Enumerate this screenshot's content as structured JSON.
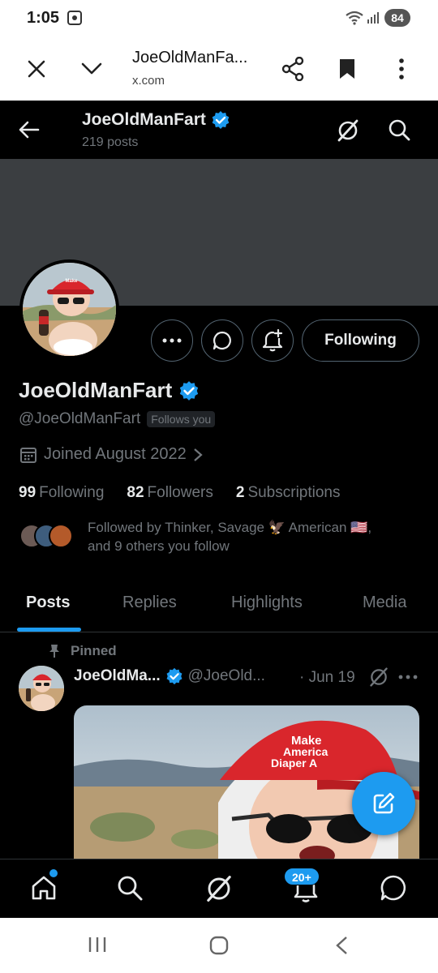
{
  "status_bar": {
    "time": "1:05",
    "battery": "84"
  },
  "browser": {
    "page_title": "JoeOldManFa...",
    "domain": "x.com"
  },
  "header": {
    "display_name": "JoeOldManFart",
    "post_count": "219 posts"
  },
  "profile": {
    "display_name": "JoeOldManFart",
    "handle": "@JoeOldManFart",
    "follows_you": "Follows you",
    "joined": "Joined August 2022",
    "follow_button": "Following",
    "stats": {
      "following_count": "99",
      "following_label": "Following",
      "followers_count": "82",
      "followers_label": "Followers",
      "subscriptions_count": "2",
      "subscriptions_label": "Subscriptions"
    },
    "followed_by_line1": "Followed by Thinker, Savage 🦅 American 🇺🇸,",
    "followed_by_line2": "and 9 others you follow"
  },
  "tabs": [
    {
      "label": "Posts",
      "active": true
    },
    {
      "label": "Replies",
      "active": false
    },
    {
      "label": "Highlights",
      "active": false
    },
    {
      "label": "Media",
      "active": false
    }
  ],
  "post": {
    "pinned_label": "Pinned",
    "name": "JoeOldMa...",
    "handle": "@JoeOld...",
    "date": "· Jun 19",
    "hat_text_1": "Make",
    "hat_text_2": "America",
    "hat_text_3": "Diaper A"
  },
  "bottom_nav": {
    "notification_badge": "20+"
  },
  "colors": {
    "accent": "#1d9bf0",
    "background": "#000000",
    "text_primary": "#e7e9ea",
    "text_secondary": "#71767b",
    "banner": "#3b3e41"
  },
  "icons": {
    "close": "close-icon",
    "chevron": "chevron-down-icon",
    "share": "share-icon",
    "bookmark": "bookmark-icon",
    "more": "more-vertical-icon",
    "back": "back-arrow-icon",
    "grok": "grok-icon",
    "search": "search-icon",
    "verified": "verified-badge-icon",
    "message": "message-icon",
    "notify": "bell-plus-icon",
    "calendar": "calendar-icon",
    "pin": "pin-icon",
    "compose": "compose-icon",
    "home": "home-icon",
    "bell": "bell-icon",
    "messages": "messages-icon"
  }
}
